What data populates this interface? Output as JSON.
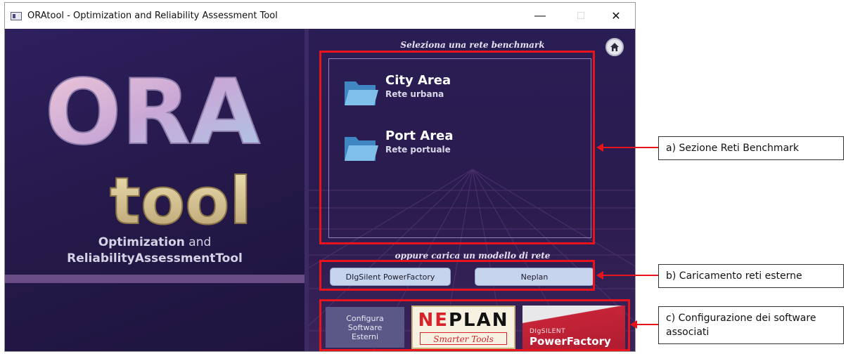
{
  "window": {
    "title": "ORAtool - Optimization and Reliability Assessment Tool",
    "controls": {
      "minimize": "—",
      "maximize": "□",
      "close": "✕"
    }
  },
  "left": {
    "logo_text": "ORA",
    "logo_sub": "tool",
    "tagline_bold_1": "Optimization",
    "tagline_rest_1": " and",
    "tagline_line_2": "ReliabilityAssessmentTool"
  },
  "right": {
    "benchmark_caption": "Seleziona una rete benchmark",
    "networks": [
      {
        "title": "City Area",
        "subtitle": "Rete urbana"
      },
      {
        "title": "Port Area",
        "subtitle": "Rete portuale"
      }
    ],
    "load_caption": "oppure carica un modello di rete",
    "external_buttons": [
      "DIgSilent PowerFactory",
      "Neplan"
    ],
    "config_button_lines": [
      "Configura",
      "Software",
      "Esterni"
    ],
    "neplan_logo": {
      "word_red": "NE",
      "word_black": "PLAN",
      "tagline": "Smarter Tools"
    },
    "powerfactory_logo": {
      "brand": "DIgSILENT",
      "name": "PowerFactory"
    }
  },
  "annotations": [
    {
      "label": "a) Sezione Reti Benchmark"
    },
    {
      "label": "b) Caricamento reti esterne"
    },
    {
      "label": "c) Configurazione dei software associati"
    }
  ],
  "colors": {
    "highlight": "#e8141c",
    "window_bg": "#2a1c4e",
    "button": "#c6d4ee"
  }
}
